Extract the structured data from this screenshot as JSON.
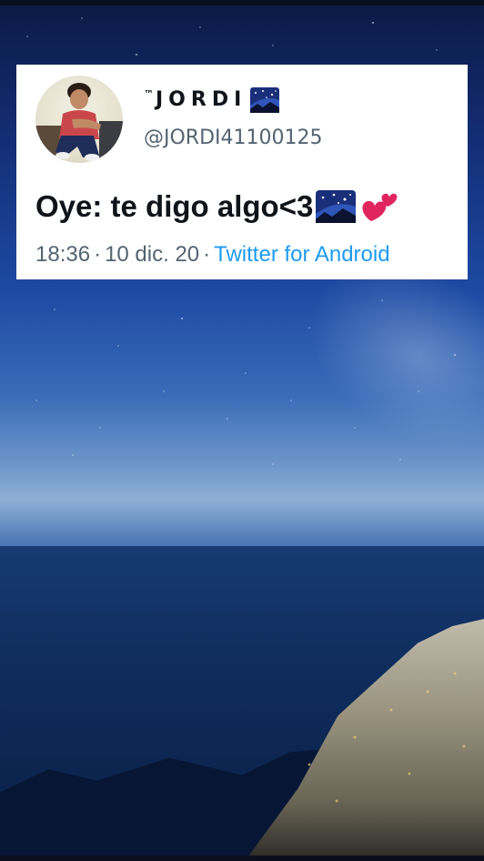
{
  "tweet": {
    "display_name": "JORDI",
    "trademark": "™",
    "display_name_emoji": "milky-way-icon",
    "username": "@JORDI41100125",
    "text": "Oye: te digo algo<3",
    "text_emojis": [
      "milky-way-icon",
      "two-hearts-icon"
    ],
    "time": "18:36",
    "date": "10 dic. 20",
    "separator": "·",
    "source": "Twitter for Android"
  },
  "colors": {
    "card_background": "#ffffff",
    "text_primary": "#0f1419",
    "text_secondary": "#536471",
    "link_blue": "#1d9bf0",
    "heart_red": "#e0245e"
  }
}
